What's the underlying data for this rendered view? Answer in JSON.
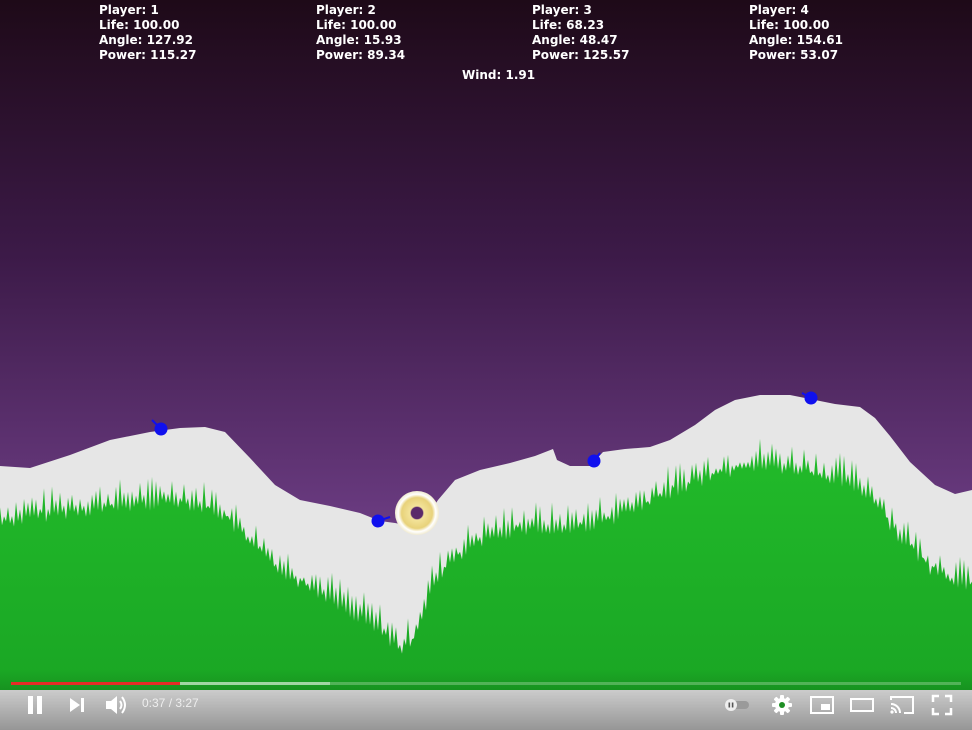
{
  "players": [
    {
      "labels": {
        "player": "Player: ",
        "life": "Life: ",
        "angle": "Angle: ",
        "power": "Power: "
      },
      "player": "1",
      "life": "100.00",
      "angle": "127.92",
      "power": "115.27"
    },
    {
      "labels": {
        "player": "Player: ",
        "life": "Life: ",
        "angle": "Angle: ",
        "power": "Power: "
      },
      "player": "2",
      "life": "100.00",
      "angle": "15.93",
      "power": "89.34"
    },
    {
      "labels": {
        "player": "Player: ",
        "life": "Life: ",
        "angle": "Angle: ",
        "power": "Power: "
      },
      "player": "3",
      "life": "68.23",
      "angle": "48.47",
      "power": "125.57"
    },
    {
      "labels": {
        "player": "Player: ",
        "life": "Life: ",
        "angle": "Angle: ",
        "power": "Power: "
      },
      "player": "4",
      "life": "100.00",
      "angle": "154.61",
      "power": "53.07"
    }
  ],
  "wind": {
    "label": "Wind: ",
    "value": "1.91"
  },
  "colors": {
    "sky_top": "#1e0a18",
    "sky_bottom": "#8e55ad",
    "terrain": "#e6e6e6",
    "grass": "#22bb2a",
    "tank": "#1010ee",
    "explosion": "#e8d27a"
  },
  "video": {
    "current_time": "0:37",
    "separator": " / ",
    "duration": "3:27",
    "played_fraction": 0.178,
    "buffered_fraction": 0.336
  },
  "icons": {
    "pause": "pause-icon",
    "next": "next-icon",
    "volume": "volume-icon",
    "autoplay": "autoplay-toggle-icon",
    "settings": "gear-icon",
    "miniplayer": "miniplayer-icon",
    "theater": "theater-mode-icon",
    "cast": "cast-icon",
    "fullscreen": "fullscreen-icon"
  }
}
